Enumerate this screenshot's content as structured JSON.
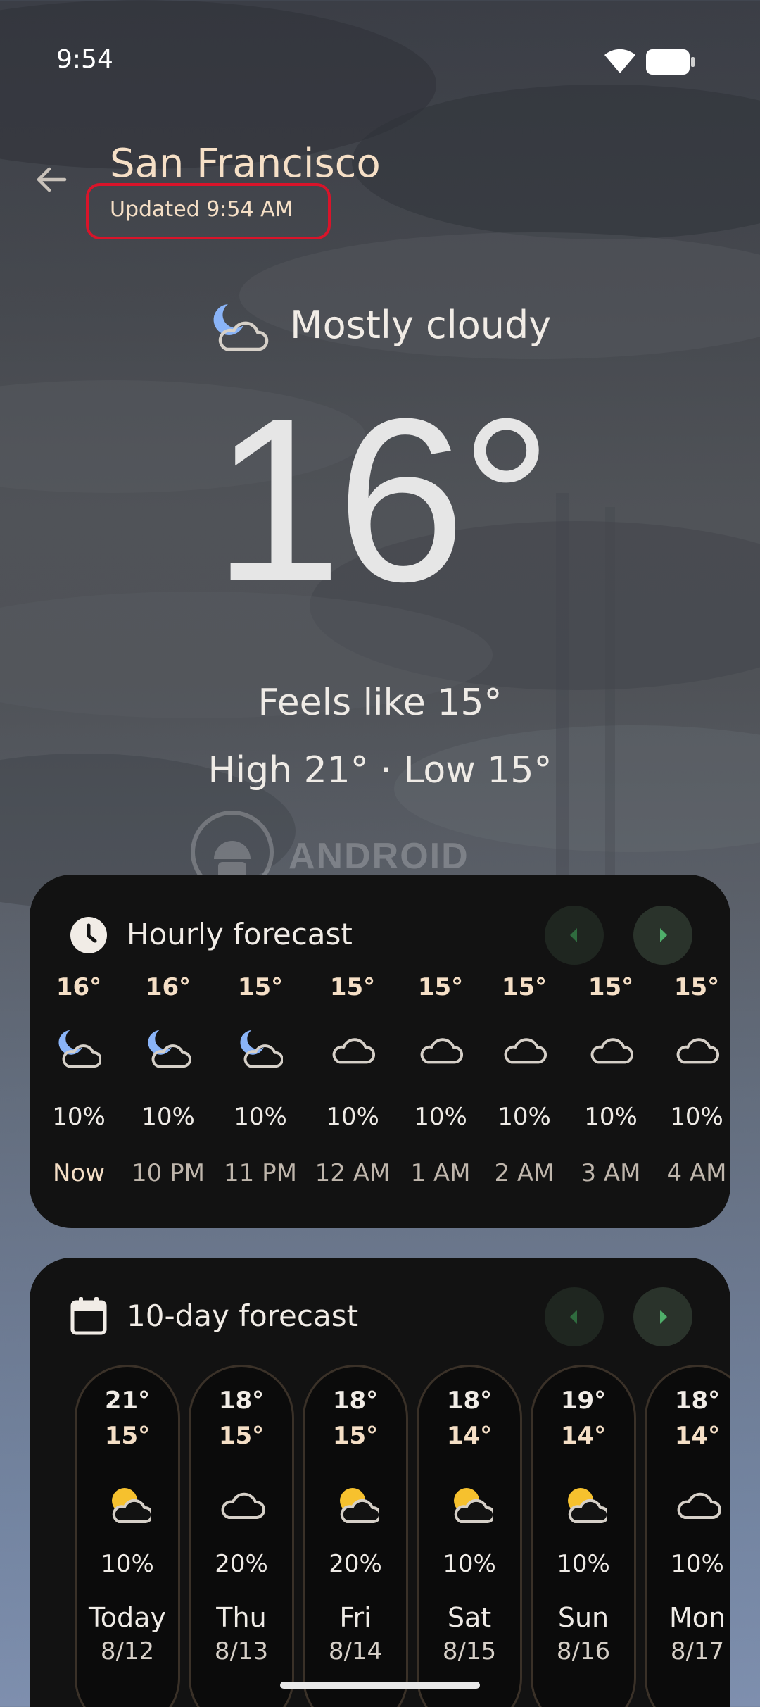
{
  "status_bar": {
    "time": "9:54"
  },
  "header": {
    "city": "San Francisco",
    "updated": "Updated 9:54 AM"
  },
  "current": {
    "condition": "Mostly cloudy",
    "condition_icon": "moon-cloud-icon",
    "temperature": "16°",
    "feels_like": "Feels like 15°",
    "high_low": "High 21° · Low 15°"
  },
  "watermark": {
    "text": "ANDROID AUTHORITY"
  },
  "hourly": {
    "title": "Hourly forecast",
    "items": [
      {
        "temp": "16°",
        "icon": "moon-cloud-icon",
        "precip": "10%",
        "label": "Now"
      },
      {
        "temp": "16°",
        "icon": "moon-cloud-icon",
        "precip": "10%",
        "label": "10 PM"
      },
      {
        "temp": "15°",
        "icon": "moon-cloud-icon",
        "precip": "10%",
        "label": "11 PM"
      },
      {
        "temp": "15°",
        "icon": "cloud-icon",
        "precip": "10%",
        "label": "12 AM"
      },
      {
        "temp": "15°",
        "icon": "cloud-icon",
        "precip": "10%",
        "label": "1 AM"
      },
      {
        "temp": "15°",
        "icon": "cloud-icon",
        "precip": "10%",
        "label": "2 AM"
      },
      {
        "temp": "15°",
        "icon": "cloud-icon",
        "precip": "10%",
        "label": "3 AM"
      },
      {
        "temp": "15°",
        "icon": "cloud-icon",
        "precip": "10%",
        "label": "4 AM"
      }
    ]
  },
  "daily": {
    "title": "10-day forecast",
    "items": [
      {
        "high": "21°",
        "low": "15°",
        "icon": "sun-cloud-icon",
        "precip": "10%",
        "day": "Today",
        "date": "8/12"
      },
      {
        "high": "18°",
        "low": "15°",
        "icon": "cloud-icon",
        "precip": "20%",
        "day": "Thu",
        "date": "8/13"
      },
      {
        "high": "18°",
        "low": "15°",
        "icon": "sun-cloud-icon",
        "precip": "20%",
        "day": "Fri",
        "date": "8/14"
      },
      {
        "high": "18°",
        "low": "14°",
        "icon": "sun-cloud-icon",
        "precip": "10%",
        "day": "Sat",
        "date": "8/15"
      },
      {
        "high": "19°",
        "low": "14°",
        "icon": "sun-cloud-icon",
        "precip": "10%",
        "day": "Sun",
        "date": "8/16"
      },
      {
        "high": "18°",
        "low": "14°",
        "icon": "cloud-icon",
        "precip": "10%",
        "day": "Mon",
        "date": "8/17"
      }
    ]
  },
  "colors": {
    "accent_cream": "#f5dfc6",
    "highlight_red": "#d9142a",
    "card_bg": "#121212",
    "nav_arrow_green": "#4fae6a"
  }
}
